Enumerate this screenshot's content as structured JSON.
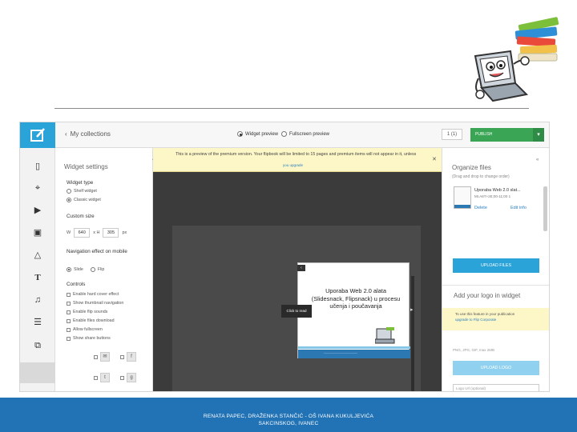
{
  "topbar": {
    "back_label": "My collections",
    "widget_preview_label": "Widget preview",
    "fullscreen_preview_label": "Fullscreen preview",
    "page_number": "1 (1)",
    "publish_label": "PUBLISH"
  },
  "widget_settings": {
    "title": "Widget settings",
    "widget_type_heading": "Widget type",
    "shelf_widget": "Shelf widget",
    "classic_widget": "Classic widget",
    "custom_size_heading": "Custom size",
    "width_label": "W",
    "width_value": "640",
    "height_label": "x H",
    "height_value": "305",
    "unit": "px",
    "nav_heading": "Navigation effect on mobile",
    "nav_slide": "Slide",
    "nav_flip": "Flip",
    "controls_heading": "Controls",
    "controls": [
      "Enable hard cover effect",
      "Show thumbnail navigation",
      "Enable flip sounds",
      "Enable files download",
      "Allow fullscreen",
      "Show share buttons"
    ]
  },
  "preview": {
    "notice": "This is a preview of the premium version. Your flipbook will be limited to 15 pages and premium items will not appear in it, unless",
    "notice_link": "you upgrade",
    "book_title": "Uporaba Web 2.0 alata (Slidesnack, Flipsnack) u procesu učenja i poučavanja",
    "click_to_read": "Click to read"
  },
  "organize": {
    "title": "Organize files",
    "subtitle": "(Drag and drop to change order)",
    "file_name": "Uporaba Web 2.0 slat...",
    "file_meta": "MI.A6T+2E;00-11;00 1",
    "delete_label": "Delete",
    "edit_info_label": "Edit info",
    "upload_files": "UPLOAD FILES",
    "logo_title": "Add your logo in widget",
    "logo_note": "To use this feature in your publication",
    "logo_note_link": "upgrade to Flip Corporate",
    "png_hint": "PNG, JPG, GIF, max 2MB",
    "upload_logo": "UPLOAD LOGO",
    "logo_url_placeholder": "Logo Url (optional)"
  },
  "footer": {
    "line1": "RENATA PAPEC, DRAŽENKA STANČIĆ - OŠ IVANA KUKULJEVIĆA",
    "line2": "SAKCINSKOG, IVANEC"
  },
  "colors": {
    "accent_blue": "#2aa3d8",
    "publish_green": "#3aa655",
    "notice_yellow": "#fdf7c7",
    "footer_blue": "#2273b5"
  }
}
